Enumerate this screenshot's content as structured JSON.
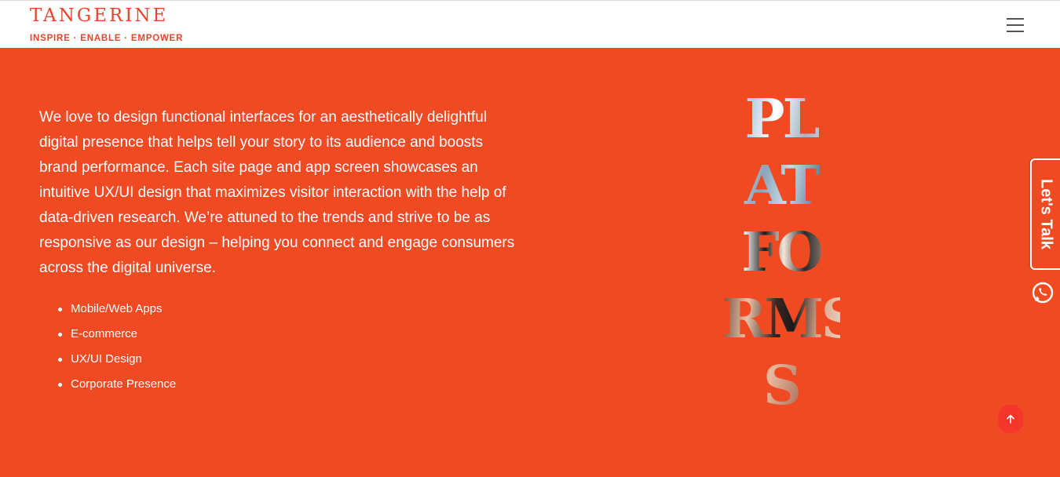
{
  "header": {
    "logo_name": "TANGERINE",
    "logo_tagline": "INSPIRE · ENABLE · EMPOWER",
    "menu_icon": "hamburger-menu-icon"
  },
  "content": {
    "intro": "We love to design functional interfaces for an aesthetically delightful digital presence that helps tell your story to its audience and boosts brand performance. Each site page and app screen showcases an intuitive UX/UI design that maximizes visitor interaction with the help of data-driven research. We’re attuned to the trends and strive to be as responsive as our design – helping you connect and engage consumers across the digital universe.",
    "bullets": [
      "Mobile/Web Apps",
      "E-commerce",
      "UX/UI Design",
      "Corporate Presence"
    ]
  },
  "word_art": {
    "rows": [
      "PL",
      "AT",
      "FO",
      "RMS",
      "S"
    ]
  },
  "side_widget": {
    "lets_talk_label": "Let's Talk",
    "whatsapp_icon": "whatsapp-icon"
  },
  "scroll_top_icon": "arrow-up-icon",
  "colors": {
    "brand_orange": "#f04a23",
    "logo_red": "#e8452b",
    "scroll_button": "#f4372a"
  }
}
